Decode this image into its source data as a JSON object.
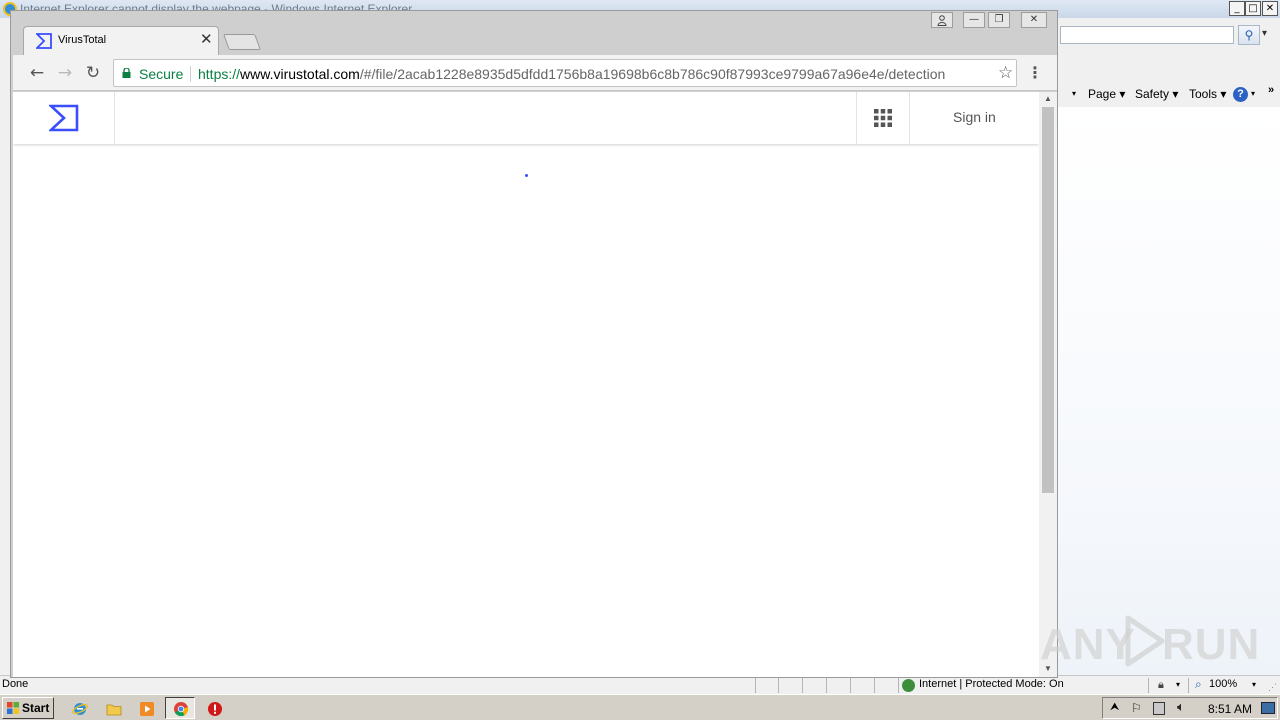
{
  "ie": {
    "title": "Internet Explorer cannot display the webpage - Windows Internet Explorer",
    "commands": {
      "page": "Page",
      "safety": "Safety",
      "tools": "Tools",
      "help_icon": "?",
      "arrow": "▾",
      "overflow": "»"
    },
    "status": {
      "text": "Done",
      "zone": "Internet | Protected Mode: On",
      "zoom": "100%"
    },
    "caption_buttons": {
      "minimize": "_",
      "maximize": "□",
      "close": "✕"
    }
  },
  "chrome": {
    "tab": {
      "title": "VirusTotal",
      "close_glyph": "✕"
    },
    "caption_buttons": {
      "profile": "👤",
      "minimize": "—",
      "restore": "❐",
      "close": "✕"
    },
    "toolbar": {
      "back_glyph": "←",
      "forward_glyph": "→",
      "reload_glyph": "↻",
      "star_glyph": "☆",
      "menu_glyph": "⋮"
    },
    "omnibox": {
      "secure_label": "Secure",
      "url_scheme": "https://",
      "url_host": "www.virustotal.com",
      "url_path": "/#/file/2acab1228e8935d5dfdd1756b8a19698b6c8b786c90f87993ce9799a67a96e4e/detection"
    }
  },
  "page": {
    "sign_in": "Sign in",
    "brand_color": "#394eff"
  },
  "taskbar": {
    "start_label": "Start",
    "clock": "8:51 AM"
  },
  "watermark": {
    "left": "ANY",
    "right": "RUN"
  },
  "icons": {
    "tab_favicon": "virustotal-logo-icon",
    "apps": "apps-grid-icon",
    "lock": "lock-icon"
  }
}
